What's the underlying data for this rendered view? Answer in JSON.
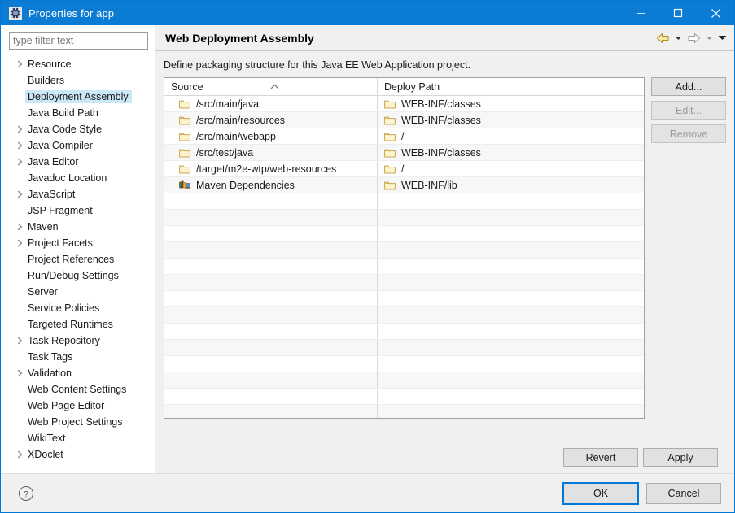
{
  "window": {
    "title": "Properties for app",
    "icon": "gear-icon",
    "accent_color": "#0b7bd4",
    "controls": {
      "minimize": "–",
      "maximize": "□",
      "close": "✕"
    }
  },
  "sidebar": {
    "filter": {
      "value": "",
      "placeholder": "type filter text"
    },
    "items": [
      {
        "label": "Resource",
        "expandable": true,
        "selected": false
      },
      {
        "label": "Builders",
        "expandable": false,
        "selected": false
      },
      {
        "label": "Deployment Assembly",
        "expandable": false,
        "selected": true
      },
      {
        "label": "Java Build Path",
        "expandable": false,
        "selected": false
      },
      {
        "label": "Java Code Style",
        "expandable": true,
        "selected": false
      },
      {
        "label": "Java Compiler",
        "expandable": true,
        "selected": false
      },
      {
        "label": "Java Editor",
        "expandable": true,
        "selected": false
      },
      {
        "label": "Javadoc Location",
        "expandable": false,
        "selected": false
      },
      {
        "label": "JavaScript",
        "expandable": true,
        "selected": false
      },
      {
        "label": "JSP Fragment",
        "expandable": false,
        "selected": false
      },
      {
        "label": "Maven",
        "expandable": true,
        "selected": false
      },
      {
        "label": "Project Facets",
        "expandable": true,
        "selected": false
      },
      {
        "label": "Project References",
        "expandable": false,
        "selected": false
      },
      {
        "label": "Run/Debug Settings",
        "expandable": false,
        "selected": false
      },
      {
        "label": "Server",
        "expandable": false,
        "selected": false
      },
      {
        "label": "Service Policies",
        "expandable": false,
        "selected": false
      },
      {
        "label": "Targeted Runtimes",
        "expandable": false,
        "selected": false
      },
      {
        "label": "Task Repository",
        "expandable": true,
        "selected": false
      },
      {
        "label": "Task Tags",
        "expandable": false,
        "selected": false
      },
      {
        "label": "Validation",
        "expandable": true,
        "selected": false
      },
      {
        "label": "Web Content Settings",
        "expandable": false,
        "selected": false
      },
      {
        "label": "Web Page Editor",
        "expandable": false,
        "selected": false
      },
      {
        "label": "Web Project Settings",
        "expandable": false,
        "selected": false
      },
      {
        "label": "WikiText",
        "expandable": false,
        "selected": false
      },
      {
        "label": "XDoclet",
        "expandable": true,
        "selected": false
      }
    ]
  },
  "page": {
    "title": "Web Deployment Assembly",
    "description": "Define packaging structure for this Java EE Web Application project.",
    "nav": {
      "back_icon": "back-arrow-icon",
      "back_dropdown_icon": "chevron-down-icon",
      "forward_icon": "forward-arrow-icon",
      "forward_dropdown_icon": "chevron-down-icon",
      "menu_icon": "chevron-down-icon"
    }
  },
  "table": {
    "columns": [
      {
        "label": "Source",
        "sort": "ascending"
      },
      {
        "label": "Deploy Path",
        "sort": null
      }
    ],
    "rows": [
      {
        "source": "/src/main/java",
        "source_icon": "folder-icon",
        "deploy": "WEB-INF/classes",
        "deploy_icon": "folder-icon"
      },
      {
        "source": "/src/main/resources",
        "source_icon": "folder-icon",
        "deploy": "WEB-INF/classes",
        "deploy_icon": "folder-icon"
      },
      {
        "source": "/src/main/webapp",
        "source_icon": "folder-icon",
        "deploy": "/",
        "deploy_icon": "folder-icon"
      },
      {
        "source": "/src/test/java",
        "source_icon": "folder-icon",
        "deploy": "WEB-INF/classes",
        "deploy_icon": "folder-icon"
      },
      {
        "source": "/target/m2e-wtp/web-resources",
        "source_icon": "folder-icon",
        "deploy": "/",
        "deploy_icon": "folder-icon"
      },
      {
        "source": "Maven Dependencies",
        "source_icon": "library-icon",
        "deploy": "WEB-INF/lib",
        "deploy_icon": "folder-icon"
      }
    ],
    "empty_row_count": 14
  },
  "side_buttons": [
    {
      "label": "Add...",
      "mnemonic": "d",
      "enabled": true,
      "name": "add-button"
    },
    {
      "label": "Edit...",
      "mnemonic": "E",
      "enabled": false,
      "name": "edit-button"
    },
    {
      "label": "Remove",
      "mnemonic": "R",
      "enabled": false,
      "name": "remove-button"
    }
  ],
  "apply_buttons": [
    {
      "label": "Revert",
      "name": "revert-button"
    },
    {
      "label": "Apply",
      "name": "apply-button"
    }
  ],
  "footer": {
    "help_icon": "help-icon",
    "ok_label": "OK",
    "cancel_label": "Cancel",
    "ok_focus_color": "#0078d7"
  }
}
